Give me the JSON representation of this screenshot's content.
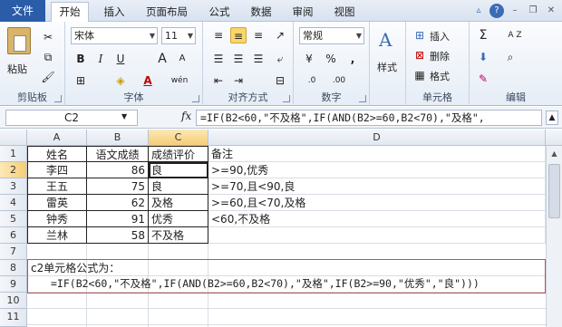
{
  "tabs": {
    "file": "文件",
    "items": [
      "开始",
      "插入",
      "页面布局",
      "公式",
      "数据",
      "审阅",
      "视图"
    ]
  },
  "ribbon": {
    "clipboard": {
      "paste": "粘贴",
      "label": "剪贴板"
    },
    "font": {
      "name": "宋体",
      "size": "11",
      "label": "字体",
      "bold": "B",
      "italic": "I",
      "underline": "U",
      "grow": "A",
      "shrink": "A",
      "color_a": "A",
      "phonetic": "wén"
    },
    "align": {
      "label": "对齐方式"
    },
    "number": {
      "format": "常规",
      "label": "数字",
      "percent": "%",
      "comma": ",",
      "inc": ".0",
      "dec": ".00"
    },
    "styles": {
      "label": "样式"
    },
    "cells": {
      "insert": "插入",
      "delete": "删除",
      "format": "格式",
      "label": "单元格"
    },
    "editing": {
      "sum": "Σ",
      "sort": "A Z",
      "label": "编辑"
    }
  },
  "formula_bar": {
    "name_box": "C2",
    "fx": "fx",
    "formula": "=IF(B2<60,\"不及格\",IF(AND(B2>=60,B2<70),\"及格\","
  },
  "columns": [
    "A",
    "B",
    "C",
    "D"
  ],
  "rows": [
    "1",
    "2",
    "3",
    "4",
    "5",
    "6",
    "7",
    "8",
    "9",
    "10",
    "11"
  ],
  "table": {
    "header": [
      "姓名",
      "语文成绩",
      "成绩评价",
      "备注"
    ],
    "data": [
      {
        "name": "李四",
        "score": "86",
        "grade": "良",
        "note": ">=90,优秀"
      },
      {
        "name": "王五",
        "score": "75",
        "grade": "良",
        "note": ">=70,且<90,良"
      },
      {
        "name": "雷英",
        "score": "62",
        "grade": "及格",
        "note": ">=60,且<70,及格"
      },
      {
        "name": "钟秀",
        "score": "91",
        "grade": "优秀",
        "note": "<60,不及格"
      },
      {
        "name": "兰林",
        "score": "58",
        "grade": "不及格",
        "note": ""
      }
    ]
  },
  "note": {
    "title": "c2单元格公式为：",
    "formula": "=IF(B2<60,\"不及格\",IF(AND(B2>=60,B2<70),\"及格\",IF(B2>=90,\"优秀\",\"良\")))"
  }
}
